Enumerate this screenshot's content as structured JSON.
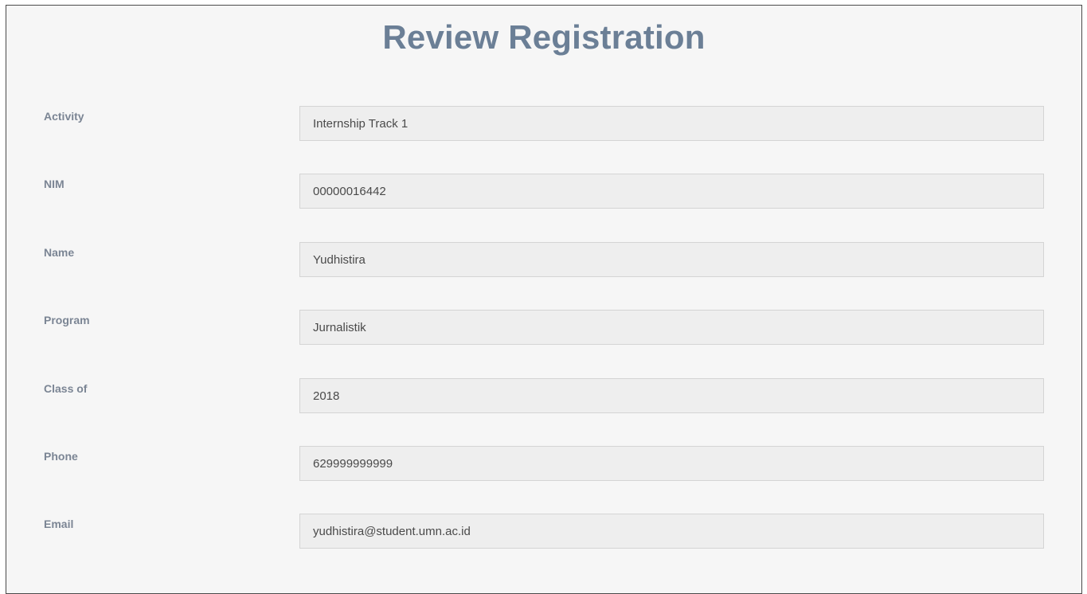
{
  "page": {
    "title": "Review Registration"
  },
  "form": {
    "fields": [
      {
        "label": "Activity",
        "value": "Internship Track 1"
      },
      {
        "label": "NIM",
        "value": "00000016442"
      },
      {
        "label": "Name",
        "value": "Yudhistira"
      },
      {
        "label": "Program",
        "value": "Jurnalistik"
      },
      {
        "label": "Class of",
        "value": "2018"
      },
      {
        "label": "Phone",
        "value": "629999999999"
      },
      {
        "label": "Email",
        "value": "yudhistira@student.umn.ac.id"
      }
    ]
  },
  "colors": {
    "title": "#6b7f96",
    "label": "#7b8594",
    "input_bg": "#eeeeee",
    "panel_bg": "#f6f6f6"
  }
}
